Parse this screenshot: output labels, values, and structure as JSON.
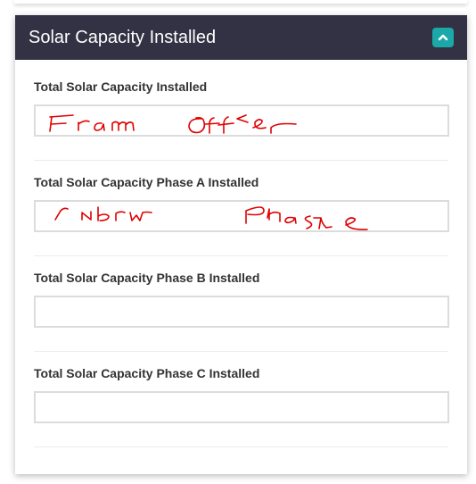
{
  "panel": {
    "title": "Solar Capacity Installed",
    "collapse_icon": "chevron-up-icon",
    "header_color": "#323244",
    "accent_color": "#1ba8a8"
  },
  "fields": [
    {
      "label": "Total Solar Capacity Installed",
      "handwritten_value": "From offer"
    },
    {
      "label": "Total Solar Capacity Phase A Installed",
      "handwritten_value": "/ Nbru Phase"
    },
    {
      "label": "Total Solar Capacity Phase B Installed",
      "value": ""
    },
    {
      "label": "Total Solar Capacity Phase C Installed",
      "value": ""
    }
  ],
  "annotation_color": "#e00000"
}
